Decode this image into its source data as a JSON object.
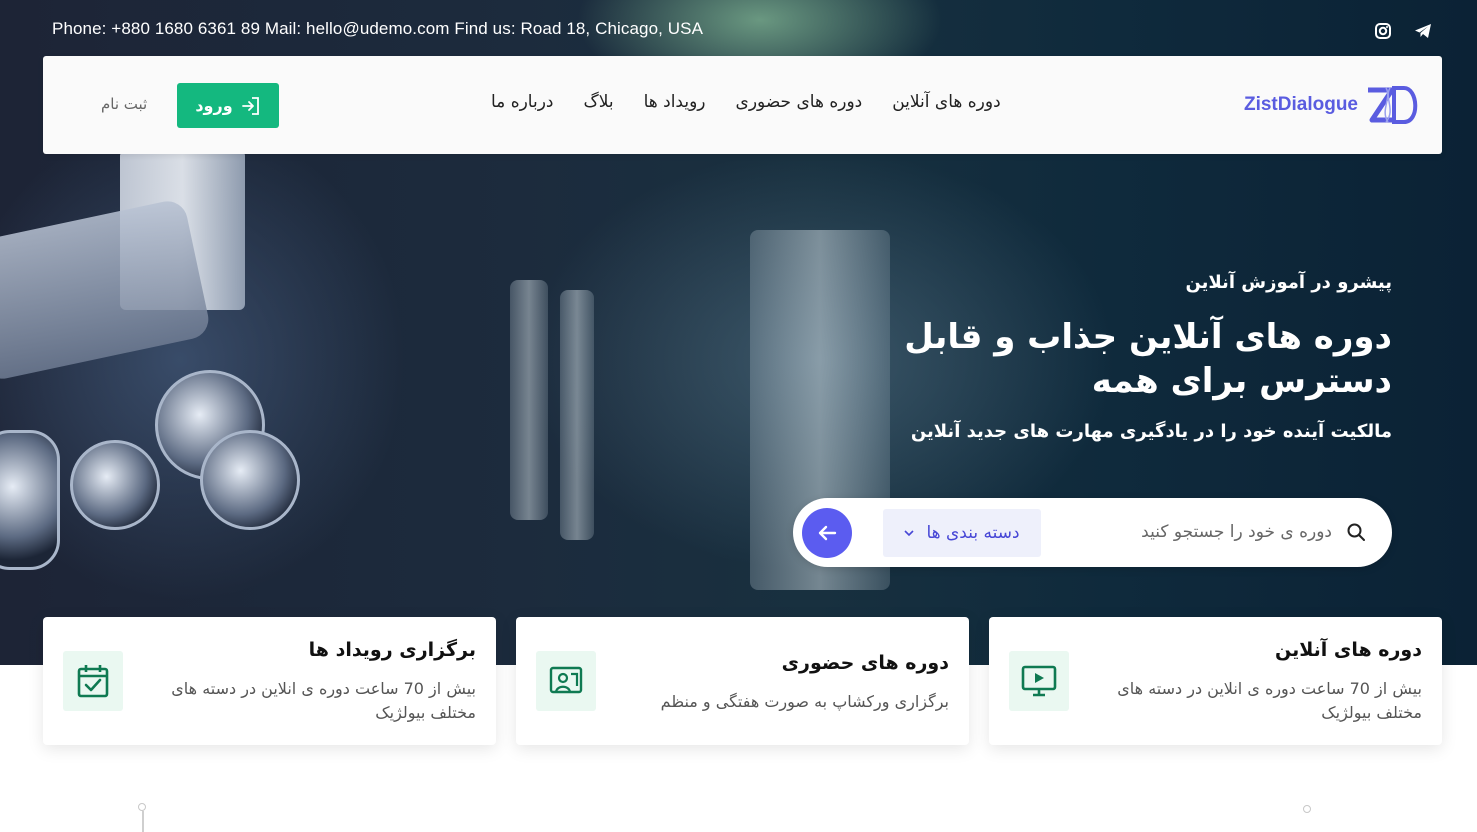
{
  "topbar": {
    "contact": "Phone: +880 1680 6361 89 Mail: hello@udemo.com Find us: Road 18, Chicago, USA",
    "social_icons": [
      "instagram-icon",
      "telegram-icon"
    ]
  },
  "navbar": {
    "logo_text": "ZistDialogue",
    "links": [
      "دوره های آنلاین",
      "دوره های حضوری",
      "رویداد ها",
      "بلاگ",
      "درباره ما"
    ],
    "login_label": "ورود",
    "register_label": "ثبت نام"
  },
  "hero": {
    "eyebrow": "پیشرو در آموزش آنلاین",
    "headline_line1": "دوره های آنلاین جذاب و قابل",
    "headline_line2": "دسترس برای همه",
    "subline": "مالکیت آینده خود را در یادگیری مهارت های جدید آنلاین"
  },
  "search": {
    "placeholder": "دوره ی خود را جستجو کنید",
    "category_label": "دسته بندی ها"
  },
  "features": [
    {
      "title": "دوره های آنلاین",
      "desc": "بیش از 70 ساعت دوره ی انلاین در دسته های مختلف بیولژیک",
      "icon": "monitor-play-icon"
    },
    {
      "title": "دوره های حضوری",
      "desc": "برگزاری ورکشاپ به صورت هفتگی و منظم",
      "icon": "presentation-board-icon"
    },
    {
      "title": "برگزاری رویداد ها",
      "desc": "بیش از 70 ساعت دوره ی انلاین در دسته های مختلف بیولژیک",
      "icon": "calendar-check-icon"
    }
  ],
  "colors": {
    "accent_green": "#14b87f",
    "accent_purple": "#5b5cf0",
    "logo_blue": "#5a5ce0",
    "icon_green": "#0f7a52"
  }
}
